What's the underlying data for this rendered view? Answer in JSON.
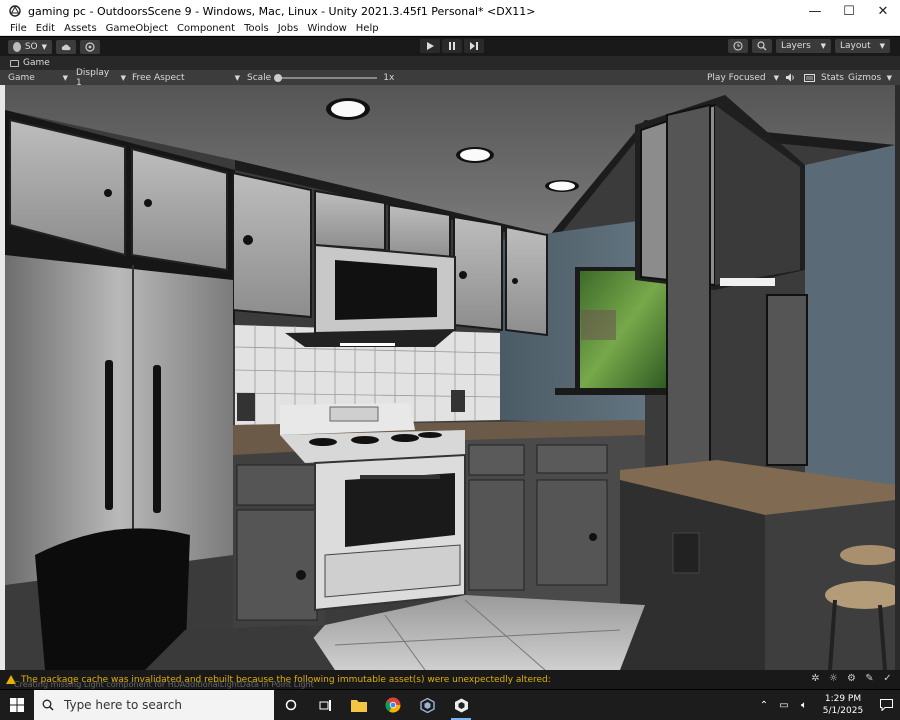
{
  "window": {
    "title": "gaming pc - OutdoorsScene 9 - Windows, Mac, Linux - Unity 2021.3.45f1 Personal* <DX11>",
    "minimize": "—",
    "maximize": "☐",
    "close": "✕"
  },
  "menu": [
    "File",
    "Edit",
    "Assets",
    "GameObject",
    "Component",
    "Tools",
    "Jobs",
    "Window",
    "Help"
  ],
  "toolbar": {
    "account": "SO",
    "layers": "Layers",
    "layout": "Layout"
  },
  "tab": {
    "label": "Game"
  },
  "gamebar": {
    "mode": "Game",
    "display": "Display 1",
    "aspect": "Free Aspect",
    "scale_label": "Scale",
    "scale_value": "1x",
    "play_focused": "Play Focused",
    "stats": "Stats",
    "gizmos": "Gizmos"
  },
  "status": {
    "message": "The package cache was invalidated and rebuilt because the following immutable asset(s) were unexpectedly altered:",
    "ghost": "Creating missing Light component for HDAdditionalLightData in Point Light"
  },
  "taskbar": {
    "search_placeholder": "Type here to search",
    "time": "1:29 PM",
    "date": "5/1/2025"
  },
  "colors": {
    "unity_dark": "#191919",
    "warning": "#e0b000",
    "taskbar_accent": "#79b6f2"
  }
}
